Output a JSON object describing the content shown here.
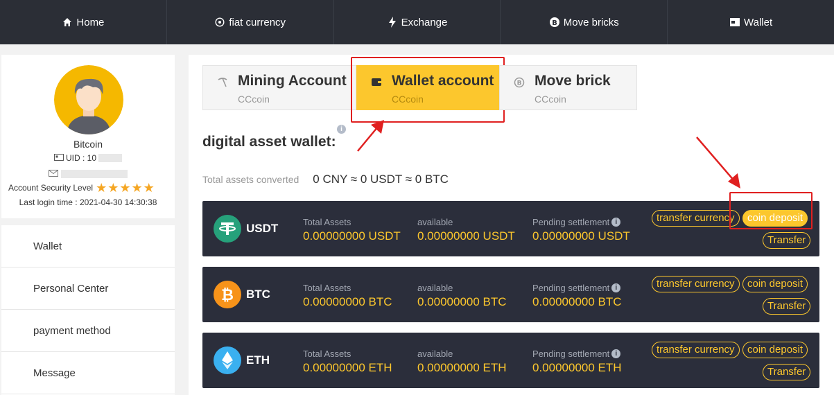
{
  "nav": [
    {
      "label": "Home",
      "icon": "home-icon"
    },
    {
      "label": "fiat currency",
      "icon": "fiat-icon"
    },
    {
      "label": "Exchange",
      "icon": "lightning-icon"
    },
    {
      "label": "Move bricks",
      "icon": "bitcoin-icon"
    },
    {
      "label": "Wallet",
      "icon": "wallet-icon"
    }
  ],
  "profile": {
    "name": "Bitcoin",
    "uid_label": "UID : 10",
    "security_label": "Account Security Level",
    "stars": "★★★★★",
    "last_login": "Last login time : 2021-04-30 14:30:38"
  },
  "sidebar": {
    "items": [
      {
        "label": "Wallet"
      },
      {
        "label": "Personal Center"
      },
      {
        "label": "payment method"
      },
      {
        "label": "Message"
      }
    ]
  },
  "tabs": [
    {
      "title": "Mining Account",
      "sub": "CCcoin",
      "icon": "pickaxe-icon",
      "active": false
    },
    {
      "title": "Wallet account",
      "sub": "CCcoin",
      "icon": "wallet-icon",
      "active": true
    },
    {
      "title": "Move brick",
      "sub": "CCcoin",
      "icon": "coin-icon",
      "active": false
    }
  ],
  "wallet": {
    "title": "digital asset wallet:",
    "info": "i",
    "total_label": "Total assets converted",
    "total_value": "0 CNY ≈ 0 USDT ≈ 0 BTC"
  },
  "labels": {
    "total_assets": "Total Assets",
    "available": "available",
    "pending": "Pending settlement"
  },
  "buttons": {
    "transfer_currency": "transfer currency",
    "coin_deposit": "coin deposit",
    "transfer": "Transfer"
  },
  "assets": [
    {
      "coin": "USDT",
      "color": "#26a17b",
      "total": "0.00000000 USDT",
      "available": "0.00000000 USDT",
      "pending": "0.00000000 USDT"
    },
    {
      "coin": "BTC",
      "color": "#f7931a",
      "total": "0.00000000 BTC",
      "available": "0.00000000 BTC",
      "pending": "0.00000000 BTC"
    },
    {
      "coin": "ETH",
      "color": "#3ab0f0",
      "total": "0.00000000 ETH",
      "available": "0.00000000 ETH",
      "pending": "0.00000000 ETH"
    }
  ],
  "colors": {
    "nav_bg": "#2b2e36",
    "accent": "#fcc72d",
    "row_bg": "#2b2e3b",
    "annotation": "#e02020"
  }
}
